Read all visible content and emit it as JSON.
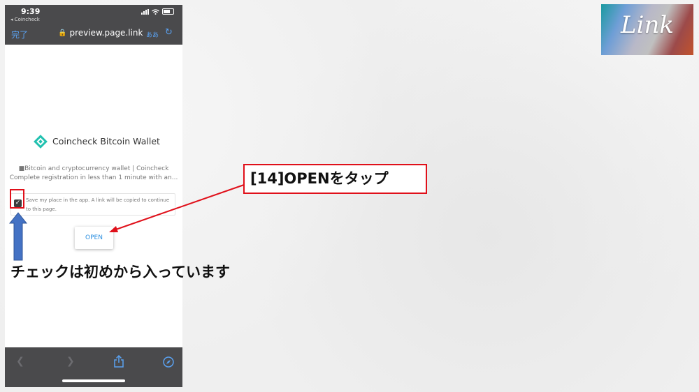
{
  "status_bar": {
    "time": "9:39",
    "back_app": "◂ Coincheck"
  },
  "browser": {
    "done_label": "完了",
    "url": "preview.page.link",
    "aa_label": "ああ",
    "reload_icon": "reload-icon"
  },
  "page": {
    "brand_name": "Coincheck Bitcoin Wallet",
    "desc_line1": "■Bitcoin and cryptocurrency wallet | Coincheck",
    "desc_line2": "Complete registration in less than 1 minute with an...",
    "save_text": "Save my place in the app. A link will be copied to continue to this page.",
    "save_checked": true,
    "open_label": "OPEN"
  },
  "toolbar": {
    "items": [
      "back-icon",
      "forward-icon",
      "share-icon",
      "compass-icon"
    ]
  },
  "annotations": {
    "callout": "[14]OPENをタップ",
    "note": "チェックは初めから入っています",
    "accent_red": "#e0101a",
    "arrow_blue": "#4472c4"
  },
  "logo": {
    "text": "Link"
  }
}
